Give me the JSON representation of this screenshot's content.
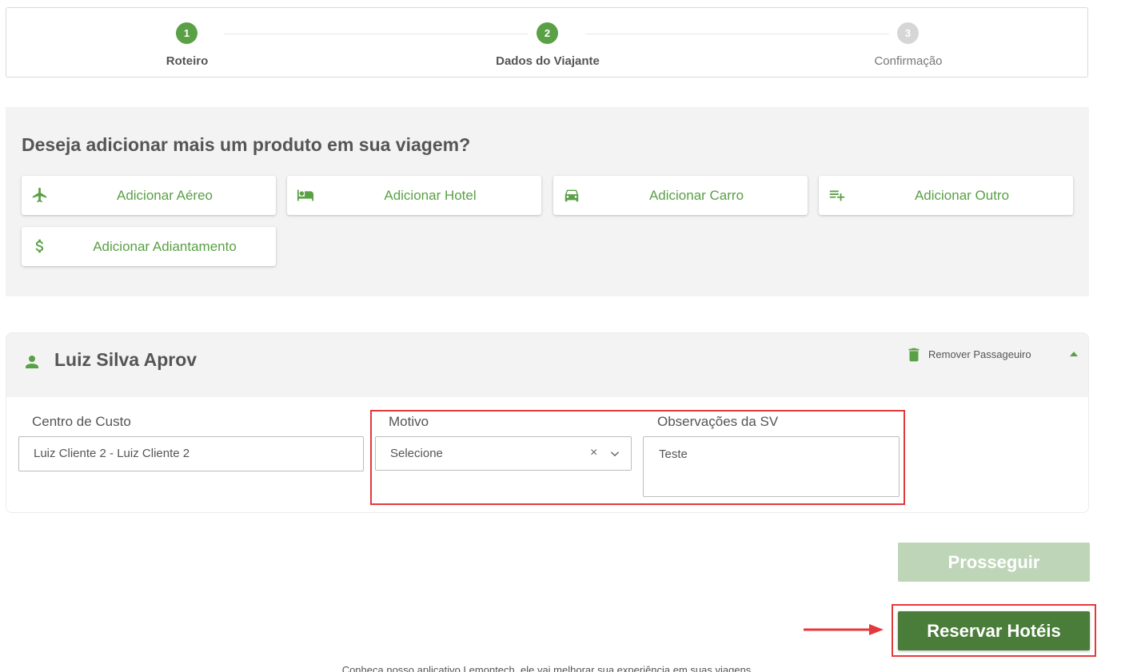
{
  "stepper": {
    "steps": [
      {
        "number": "1",
        "label": "Roteiro",
        "state": "completed"
      },
      {
        "number": "2",
        "label": "Dados do Viajante",
        "state": "active"
      },
      {
        "number": "3",
        "label": "Confirmação",
        "state": "pending"
      }
    ]
  },
  "add_product": {
    "title": "Deseja adicionar mais um produto em sua viagem?",
    "buttons": [
      {
        "label": "Adicionar Aéreo",
        "icon": "airplane-icon"
      },
      {
        "label": "Adicionar Hotel",
        "icon": "bed-icon"
      },
      {
        "label": "Adicionar Carro",
        "icon": "car-icon"
      },
      {
        "label": "Adicionar Outro",
        "icon": "playlist-add-icon"
      },
      {
        "label": "Adicionar Adiantamento",
        "icon": "dollar-icon"
      }
    ]
  },
  "passenger": {
    "name": "Luiz Silva Aprov",
    "remove_label": "Remover Passageuiro",
    "fields": {
      "cost_center": {
        "label": "Centro de Custo",
        "value": "Luiz Cliente 2 - Luiz Cliente 2"
      },
      "reason": {
        "label": "Motivo",
        "value": "Selecione"
      },
      "notes": {
        "label": "Observações da SV",
        "value": "Teste"
      }
    }
  },
  "actions": {
    "proceed_label": "Prosseguir",
    "reserve_label": "Reservar Hotéis"
  },
  "footer": {
    "text": "Conheça nosso aplicativo Lemontech, ele vai melhorar sua experiência em suas viagens"
  },
  "colors": {
    "accent": "#5aa046",
    "reserve_button": "#4b7d3a",
    "proceed_disabled": "#bed5b8",
    "highlight": "#e5383b"
  }
}
